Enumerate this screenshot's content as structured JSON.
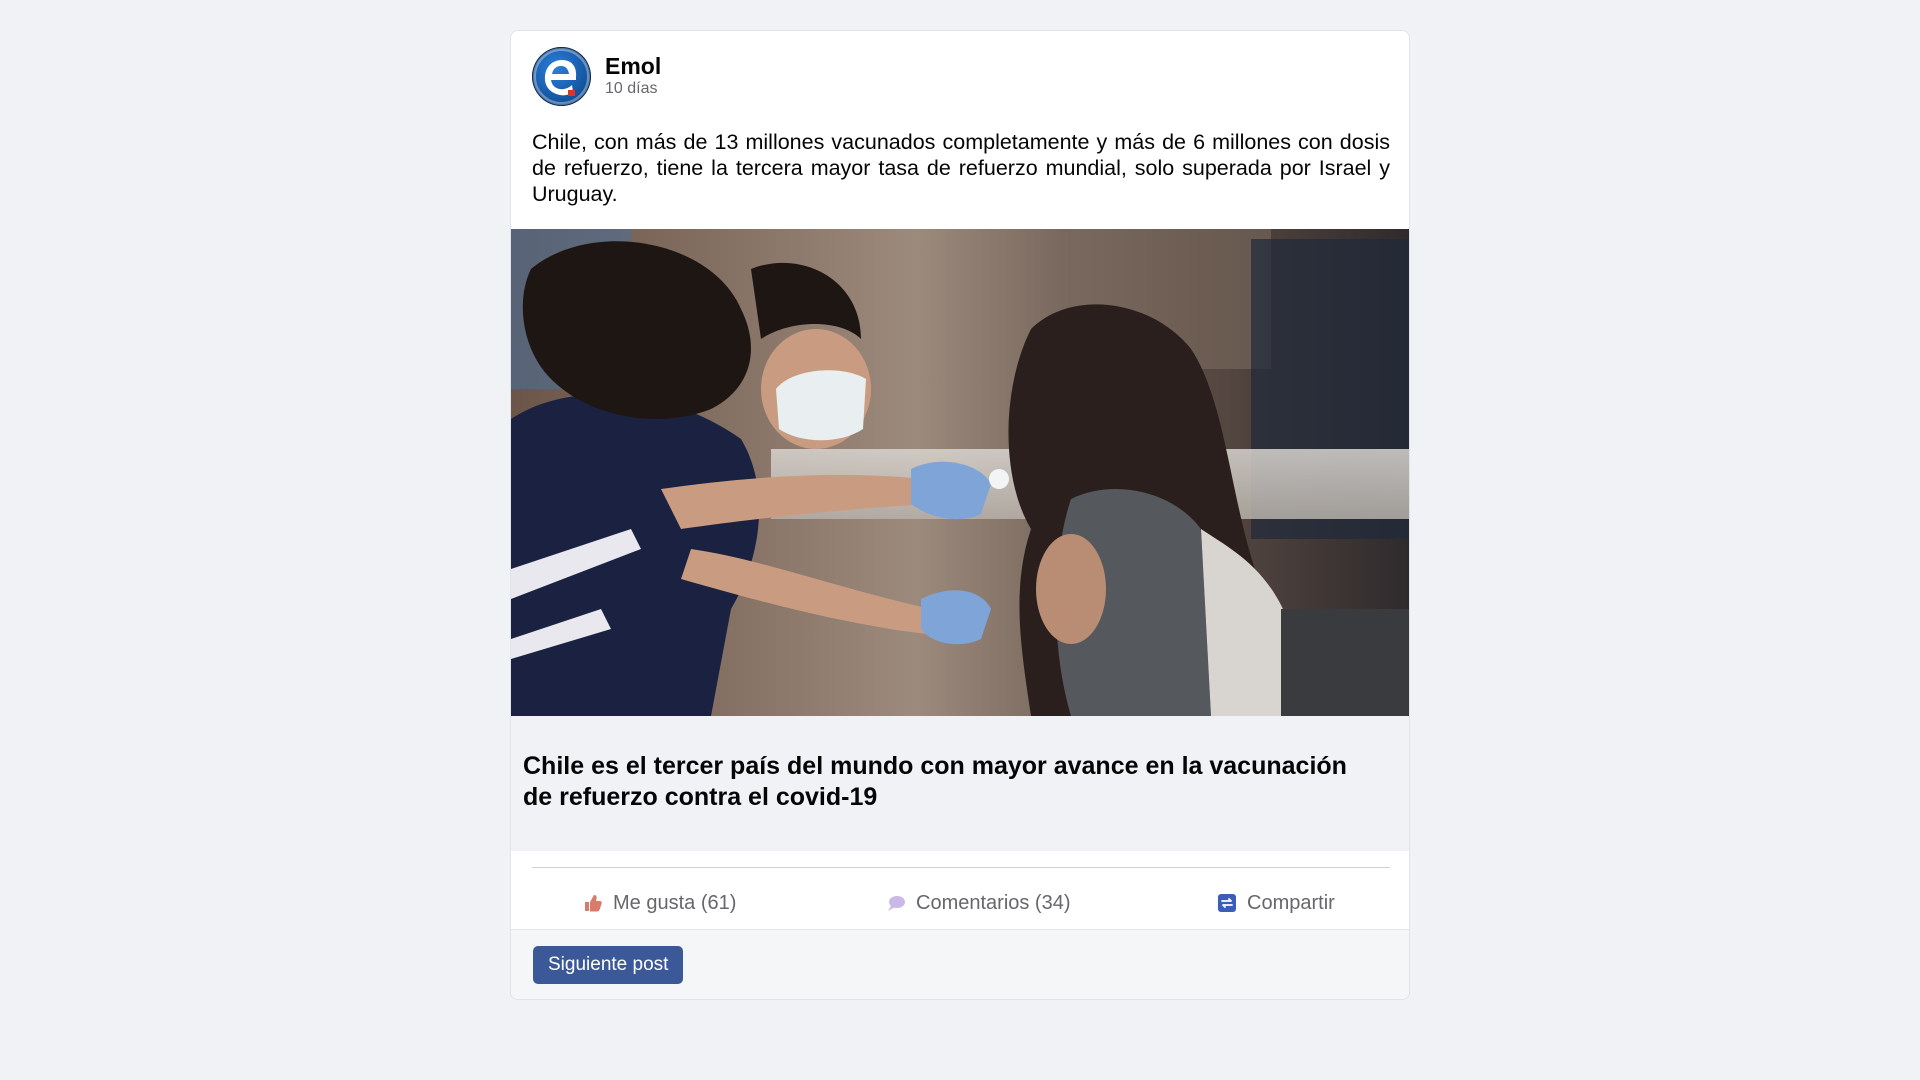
{
  "post": {
    "author": "Emol",
    "time": "10 días",
    "text": "Chile, con más de 13 millones vacunados completamente y más de 6 millones con dosis de refuerzo, tiene la tercera mayor tasa de refuerzo mundial, solo superada por Israel y Uruguay.",
    "avatar_icon": "emol-logo",
    "image_description_icon": "vaccination-photo"
  },
  "link_preview": {
    "title": "Chile es el tercer país del mundo con mayor avance en la vacunación de refuerzo contra el covid-19"
  },
  "actions": {
    "like_label": "Me gusta (61)",
    "comment_label": "Comentarios (34)",
    "share_label": "Compartir",
    "like_icon": "thumbs-up-icon",
    "comment_icon": "speech-bubble-icon",
    "share_icon": "share-icon"
  },
  "footer": {
    "next_label": "Siguiente post"
  },
  "colors": {
    "page_background": "#f0f2f5",
    "card_background": "#ffffff",
    "preview_background": "#f0f2f5",
    "button_background": "#3b5998",
    "muted_text": "#65676b"
  }
}
